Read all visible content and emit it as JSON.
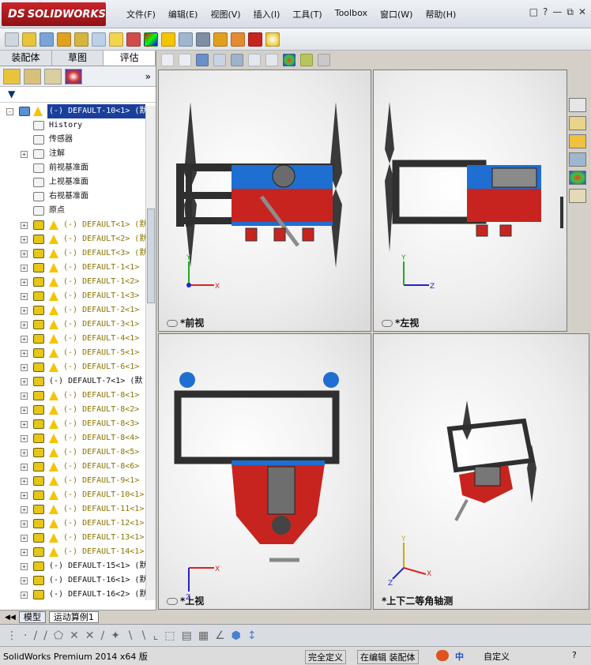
{
  "window": {
    "brand": "SOLIDWORKS",
    "brand_prefix": "DS"
  },
  "menu": [
    "文件(F)",
    "编辑(E)",
    "视图(V)",
    "插入(I)",
    "工具(T)",
    "Toolbox",
    "窗口(W)",
    "帮助(H)"
  ],
  "panel_tabs": [
    "装配体",
    "草图",
    "评估"
  ],
  "active_panel_tab": "评估",
  "filter_icon": "funnel-icon",
  "tree": {
    "root": "(-) DEFAULT-10<1> (默",
    "items": [
      {
        "label": "History",
        "style": "black",
        "icon": "history-icon",
        "warn": false,
        "expand": false
      },
      {
        "label": "传感器",
        "style": "black",
        "icon": "sensor-icon",
        "warn": false,
        "expand": false
      },
      {
        "label": "注解",
        "style": "black",
        "icon": "annotation-icon",
        "warn": false,
        "expand": true
      },
      {
        "label": "前视基准面",
        "style": "black",
        "icon": "plane-icon",
        "warn": false,
        "expand": false
      },
      {
        "label": "上视基准面",
        "style": "black",
        "icon": "plane-icon",
        "warn": false,
        "expand": false
      },
      {
        "label": "右视基准面",
        "style": "black",
        "icon": "plane-icon",
        "warn": false,
        "expand": false
      },
      {
        "label": "原点",
        "style": "black",
        "icon": "origin-icon",
        "warn": false,
        "expand": false
      },
      {
        "label": "(-) DEFAULT<1> (默",
        "style": "yellow",
        "icon": "part-icon",
        "warn": true,
        "expand": true
      },
      {
        "label": "(-) DEFAULT<2> (默",
        "style": "yellow",
        "icon": "part-icon",
        "warn": true,
        "expand": true
      },
      {
        "label": "(-) DEFAULT<3> (默",
        "style": "yellow",
        "icon": "part-icon",
        "warn": true,
        "expand": true
      },
      {
        "label": "(-) DEFAULT-1<1>",
        "style": "yellow",
        "icon": "part-icon",
        "warn": true,
        "expand": true
      },
      {
        "label": "(-) DEFAULT-1<2>",
        "style": "yellow",
        "icon": "part-icon",
        "warn": true,
        "expand": true
      },
      {
        "label": "(-) DEFAULT-1<3>",
        "style": "yellow",
        "icon": "part-icon",
        "warn": true,
        "expand": true
      },
      {
        "label": "(-) DEFAULT-2<1>",
        "style": "yellow",
        "icon": "part-icon",
        "warn": true,
        "expand": true
      },
      {
        "label": "(-) DEFAULT-3<1>",
        "style": "yellow",
        "icon": "part-icon",
        "warn": true,
        "expand": true
      },
      {
        "label": "(-) DEFAULT-4<1>",
        "style": "yellow",
        "icon": "part-icon",
        "warn": true,
        "expand": true
      },
      {
        "label": "(-) DEFAULT-5<1>",
        "style": "yellow",
        "icon": "part-icon",
        "warn": true,
        "expand": true
      },
      {
        "label": "(-) DEFAULT-6<1>",
        "style": "yellow",
        "icon": "part-icon",
        "warn": true,
        "expand": true
      },
      {
        "label": "(-) DEFAULT-7<1> (默",
        "style": "black",
        "icon": "part-icon",
        "warn": false,
        "expand": true
      },
      {
        "label": "(-) DEFAULT-8<1>",
        "style": "yellow",
        "icon": "part-icon",
        "warn": true,
        "expand": true
      },
      {
        "label": "(-) DEFAULT-8<2>",
        "style": "yellow",
        "icon": "part-icon",
        "warn": true,
        "expand": true
      },
      {
        "label": "(-) DEFAULT-8<3>",
        "style": "yellow",
        "icon": "part-icon",
        "warn": true,
        "expand": true
      },
      {
        "label": "(-) DEFAULT-8<4>",
        "style": "yellow",
        "icon": "part-icon",
        "warn": true,
        "expand": true
      },
      {
        "label": "(-) DEFAULT-8<5>",
        "style": "yellow",
        "icon": "part-icon",
        "warn": true,
        "expand": true
      },
      {
        "label": "(-) DEFAULT-8<6>",
        "style": "yellow",
        "icon": "part-icon",
        "warn": true,
        "expand": true
      },
      {
        "label": "(-) DEFAULT-9<1>",
        "style": "yellow",
        "icon": "part-icon",
        "warn": true,
        "expand": true
      },
      {
        "label": "(-) DEFAULT-10<1>",
        "style": "yellow",
        "icon": "part-icon",
        "warn": true,
        "expand": true
      },
      {
        "label": "(-) DEFAULT-11<1>",
        "style": "yellow",
        "icon": "part-icon",
        "warn": true,
        "expand": true
      },
      {
        "label": "(-) DEFAULT-12<1>",
        "style": "yellow",
        "icon": "part-icon",
        "warn": true,
        "expand": true
      },
      {
        "label": "(-) DEFAULT-13<1>",
        "style": "yellow",
        "icon": "part-icon",
        "warn": true,
        "expand": true
      },
      {
        "label": "(-) DEFAULT-14<1>",
        "style": "yellow",
        "icon": "part-icon",
        "warn": true,
        "expand": true
      },
      {
        "label": "(-) DEFAULT-15<1> (默",
        "style": "black",
        "icon": "part-icon",
        "warn": false,
        "expand": true
      },
      {
        "label": "(-) DEFAULT-16<1> (默",
        "style": "black",
        "icon": "part-icon",
        "warn": false,
        "expand": true
      },
      {
        "label": "(-) DEFAULT-16<2> (默",
        "style": "black",
        "icon": "part-icon",
        "warn": false,
        "expand": true
      }
    ]
  },
  "bottom_tabs": [
    "模型",
    "运动算例1"
  ],
  "viewports": {
    "front": "*前视",
    "left": "*左视",
    "top": "*上视",
    "iso": "*上下二等角轴测"
  },
  "axes": {
    "x": "X",
    "y": "Y",
    "z": "Z"
  },
  "status": {
    "product": "SolidWorks Premium 2014 x64 版",
    "definition": "完全定义",
    "mode": "在编辑 装配体",
    "ime": "中",
    "custom": "自定义"
  },
  "colors": {
    "accent_red": "#c8241f",
    "frame_dark": "#3c3c3c",
    "blue_part": "#1e6fd1",
    "warning": "#f5c400"
  }
}
